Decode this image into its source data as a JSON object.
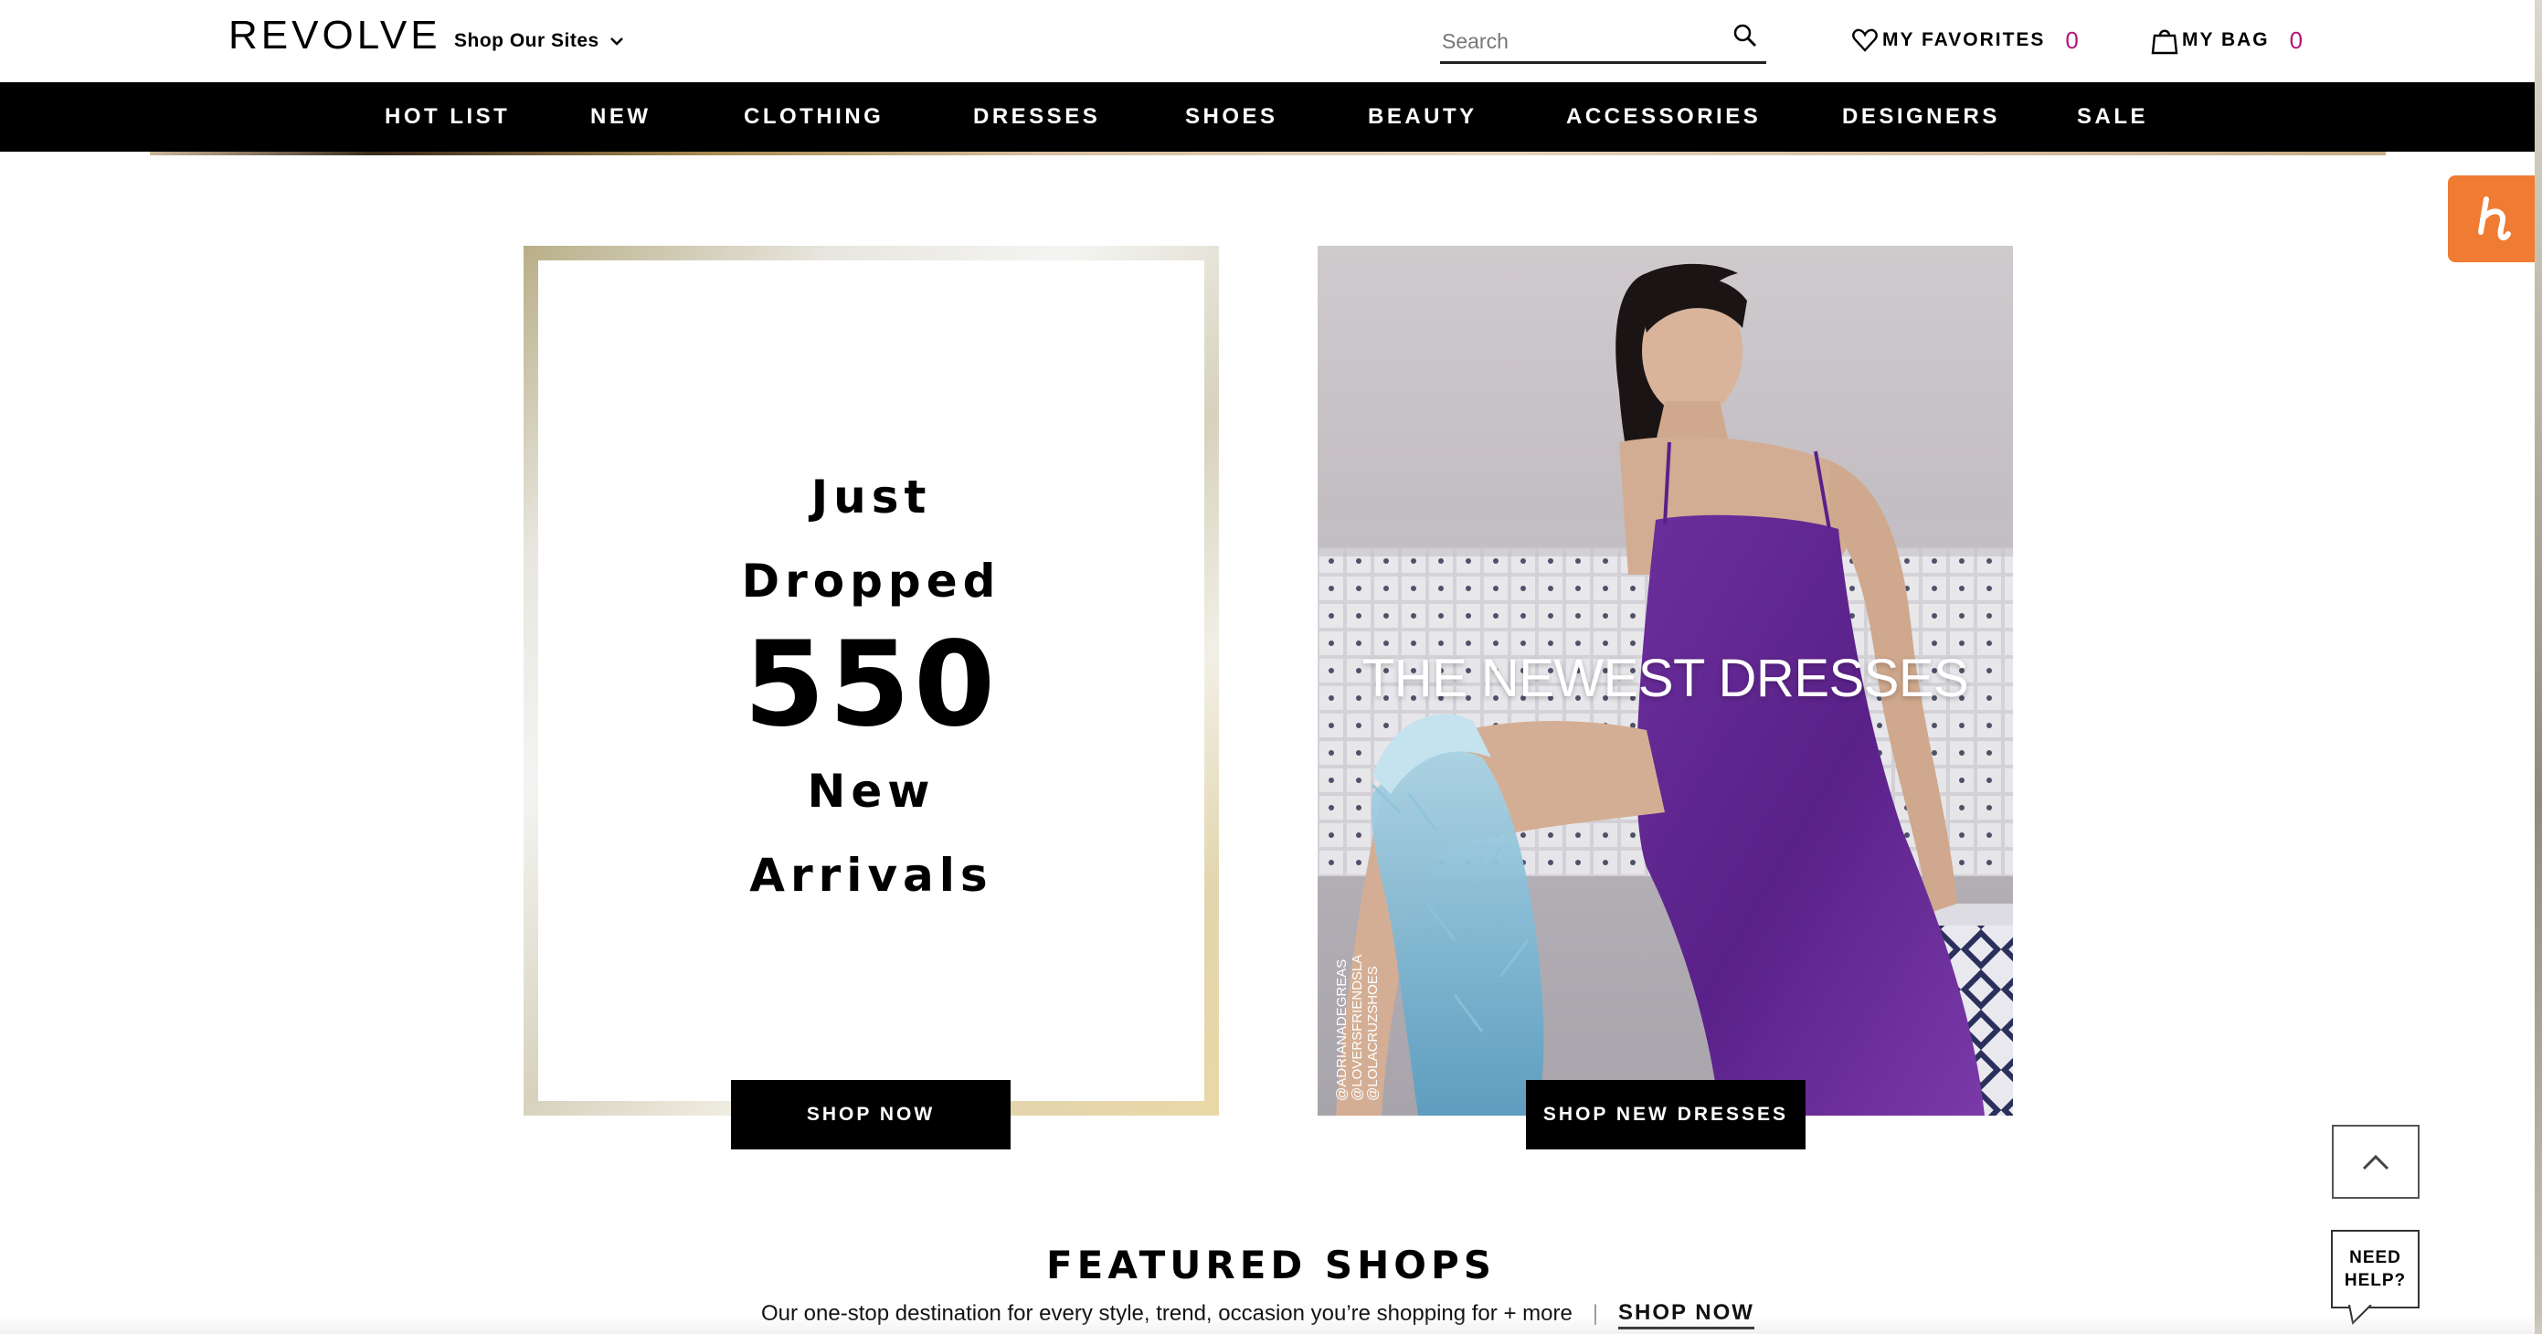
{
  "header": {
    "logo": "REVOLVE",
    "shop_our_sites": "Shop Our Sites",
    "search_placeholder": "Search",
    "favorites_label": "MY FAVORITES",
    "favorites_count": "0",
    "bag_label": "MY BAG",
    "bag_count": "0"
  },
  "nav": {
    "items": [
      "HOT LIST",
      "NEW",
      "CLOTHING",
      "DRESSES",
      "SHOES",
      "BEAUTY",
      "ACCESSORIES",
      "DESIGNERS",
      "SALE"
    ]
  },
  "promo_left": {
    "lines": [
      "Just",
      "Dropped",
      "550",
      "New",
      "Arrivals"
    ],
    "cta": "SHOP NOW"
  },
  "promo_right": {
    "headline": "THE NEWEST DRESSES",
    "credits": [
      "@ADRIANADEGREAS",
      "@LOVERSFRIENDSLA",
      "@LOLACRUZSHOES"
    ],
    "cta": "SHOP NEW DRESSES"
  },
  "featured": {
    "title": "FEATURED SHOPS",
    "subtitle": "Our one-stop destination for every style, trend, occasion you’re shopping for + more",
    "separator": "|",
    "link": "SHOP NOW"
  },
  "widgets": {
    "need_help_line1": "NEED",
    "need_help_line2": "HELP?"
  },
  "colors": {
    "accent_count": "#b5157b",
    "honey_orange": "#f07b32",
    "nav_bg": "#000000"
  }
}
